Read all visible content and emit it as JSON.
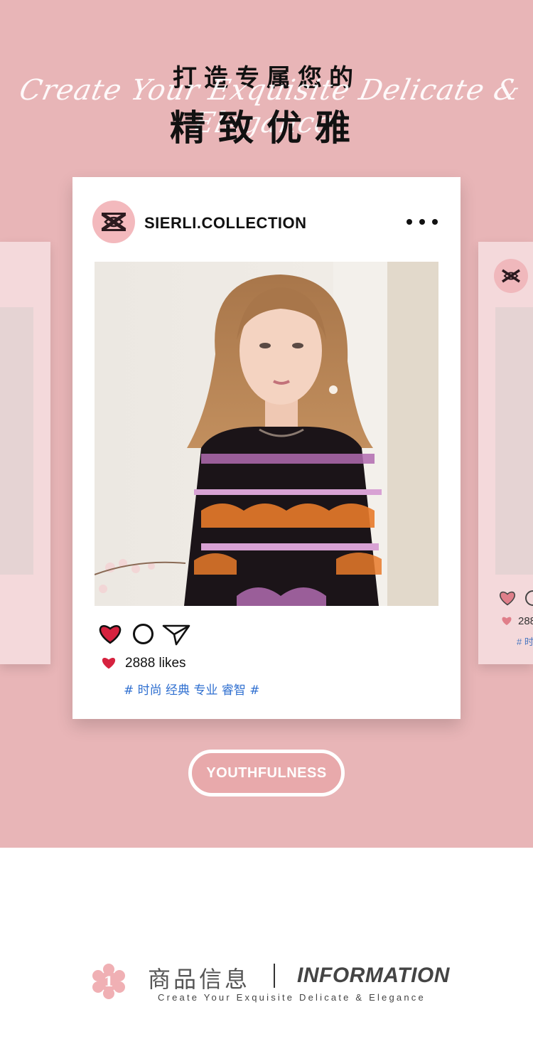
{
  "hero": {
    "headline_line1": "打造专属您的",
    "script_text": "Create Your Exquisite Delicate & Elegance",
    "headline_line2": "精致优雅",
    "background_color": "#e8b5b7"
  },
  "post": {
    "account_name": "SIERLI.COLLECTION",
    "more_icon": "more-dots-icon",
    "like_icon": "heart-icon",
    "comment_icon": "comment-circle-icon",
    "share_icon": "send-icon",
    "likes_text": "2888 likes",
    "hashtags": "# 时尚 经典 专业 睿智 #",
    "heart_color": "#d6223f",
    "tag_color": "#2f6fd0"
  },
  "side_card": {
    "likes_text": "288",
    "tags_text": "# 时"
  },
  "cta": {
    "label": "YOUTHFULNESS"
  },
  "info": {
    "badge_number": "1",
    "title_cn": "商品信息",
    "title_en": "INFORMATION",
    "subtitle": "Create Your Exquisite Delicate & Elegance"
  }
}
